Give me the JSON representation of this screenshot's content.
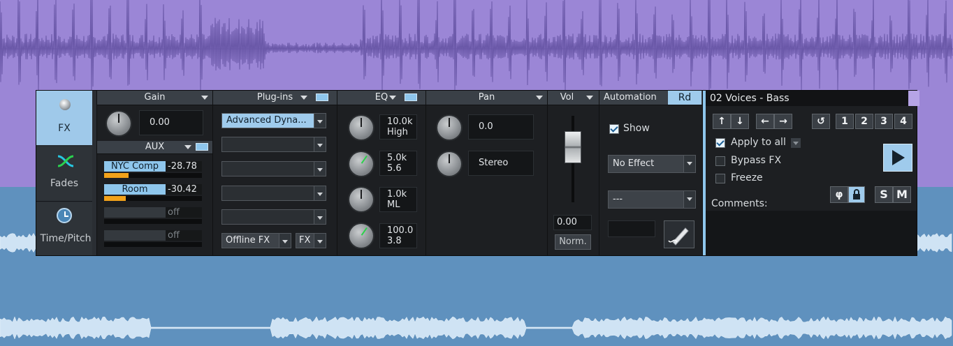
{
  "side_tabs": [
    {
      "label": "FX",
      "icon": "knob-icon"
    },
    {
      "label": "Fades",
      "icon": "fades-icon"
    },
    {
      "label": "Time/Pitch",
      "icon": "clock-icon"
    }
  ],
  "gain": {
    "header": "Gain",
    "value": "0.00"
  },
  "aux": {
    "header": "AUX",
    "sends": [
      {
        "name": "NYC Comp",
        "value": "-28.78",
        "level": 0.25
      },
      {
        "name": "Room",
        "value": "-30.42",
        "level": 0.22
      },
      {
        "name": "",
        "value": "off",
        "level": 0
      },
      {
        "name": "",
        "value": "off",
        "level": 0
      }
    ]
  },
  "plugins": {
    "header": "Plug-ins",
    "slots": [
      "Advanced Dyna...",
      "",
      "",
      "",
      ""
    ],
    "offline_fx_label": "Offline FX",
    "fx_label": "FX"
  },
  "eq": {
    "header": "EQ",
    "bands": [
      {
        "line1": "10.0k",
        "line2": "High"
      },
      {
        "line1": "5.0k",
        "line2": "5.6"
      },
      {
        "line1": "1.0k",
        "line2": "ML"
      },
      {
        "line1": "100.0",
        "line2": "3.8"
      }
    ]
  },
  "pan": {
    "header": "Pan",
    "value": "0.0",
    "mode": "Stereo"
  },
  "vol": {
    "header": "Vol",
    "value": "0.00",
    "norm_label": "Norm."
  },
  "automation": {
    "header": "Automation",
    "mode": "Rd",
    "show_label": "Show",
    "effect_value": "No Effect",
    "param_value": "---"
  },
  "track": {
    "name": "02 Voices - Bass",
    "presets": [
      "1",
      "2",
      "3",
      "4"
    ],
    "apply_to_all": "Apply to all",
    "bypass_fx": "Bypass FX",
    "freeze": "Freeze",
    "comments_label": "Comments:",
    "phase_symbol": "φ",
    "solo_label": "S",
    "mute_label": "M"
  },
  "colors": {
    "accent": "#8ec6ec",
    "meter": "#f2a21a",
    "track_top": "#9b86d6",
    "track_bottom": "#5f91be"
  }
}
